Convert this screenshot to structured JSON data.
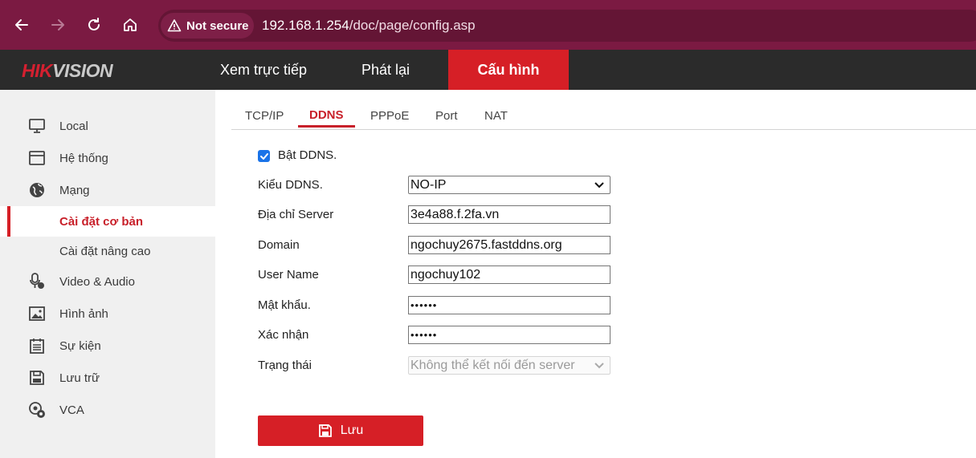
{
  "browser": {
    "security_label": "Not secure",
    "url_host": "192.168.1.254",
    "url_path": "/doc/page/config.asp"
  },
  "header": {
    "logo_part1": "HIK",
    "logo_part2": "VISION",
    "tabs": [
      {
        "label": "Xem trực tiếp",
        "active": false
      },
      {
        "label": "Phát lại",
        "active": false
      },
      {
        "label": "Cấu hình",
        "active": true
      }
    ]
  },
  "sidebar": {
    "items": [
      {
        "label": "Local",
        "icon": "monitor-icon"
      },
      {
        "label": "Hệ thống",
        "icon": "system-icon"
      },
      {
        "label": "Mạng",
        "icon": "globe-icon"
      },
      {
        "label": "Cài đặt cơ bản",
        "active": true
      },
      {
        "label": "Cài đặt nâng cao"
      },
      {
        "label": "Video & Audio",
        "icon": "video-audio-icon"
      },
      {
        "label": "Hình ảnh",
        "icon": "image-icon"
      },
      {
        "label": "Sự kiện",
        "icon": "event-icon"
      },
      {
        "label": "Lưu trữ",
        "icon": "storage-icon"
      },
      {
        "label": "VCA",
        "icon": "vca-icon"
      }
    ]
  },
  "tabs": [
    {
      "label": "TCP/IP"
    },
    {
      "label": "DDNS",
      "active": true
    },
    {
      "label": "PPPoE"
    },
    {
      "label": "Port"
    },
    {
      "label": "NAT"
    }
  ],
  "form": {
    "enable_ddns_label": "Bật DDNS.",
    "enable_ddns_checked": true,
    "ddns_type_label": "Kiểu DDNS.",
    "ddns_type_value": "NO-IP",
    "server_label": "Địa chỉ Server",
    "server_value": "3e4a88.f.2fa.vn",
    "domain_label": "Domain",
    "domain_value": "ngochuy2675.fastddns.org",
    "username_label": "User Name",
    "username_value": "ngochuy102",
    "password_label": "Mật khẩu.",
    "password_value": "••••••",
    "confirm_label": "Xác nhận",
    "confirm_value": "••••••",
    "status_label": "Trạng thái",
    "status_value": "Không thể kết nối đến server"
  },
  "save_button": {
    "label": "Lưu"
  },
  "colors": {
    "browser_bar": "#7b1a42",
    "accent_red": "#d61f26",
    "header_dark": "#2b2b2b",
    "sidebar_bg": "#f0f0f0",
    "checkbox_blue": "#1a73e8"
  }
}
